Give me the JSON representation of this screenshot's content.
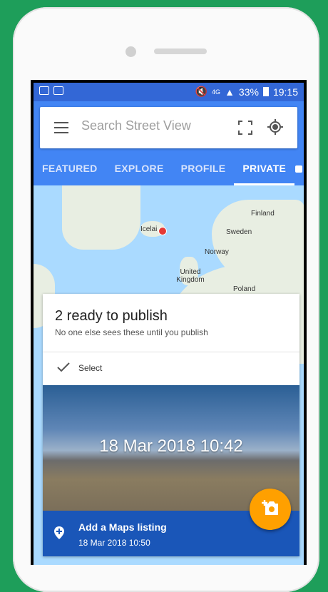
{
  "status_bar": {
    "battery": "33%",
    "time": "19:15",
    "network": "4G"
  },
  "search": {
    "placeholder": "Search Street View"
  },
  "tabs": [
    {
      "label": "FEATURED"
    },
    {
      "label": "EXPLORE"
    },
    {
      "label": "PROFILE"
    },
    {
      "label": "PRIVATE",
      "active": true
    }
  ],
  "map_labels": [
    "Icelai",
    "Finland",
    "Sweden",
    "Norway",
    "United Kingdom",
    "Poland"
  ],
  "card": {
    "title": "2 ready to publish",
    "subtitle": "No one else sees these until you publish",
    "select_label": "Select",
    "photo_date": "18 Mar 2018 10:42",
    "listing_title": "Add a Maps listing",
    "listing_date": "18 Mar 2018 10:50"
  },
  "colors": {
    "accent": "#4285f4",
    "status_bar": "#3367d6",
    "fab": "#ffa000",
    "listing": "#1a56b8",
    "pin": "#e53935"
  },
  "icons": [
    "menu-icon",
    "fullscreen-icon",
    "my-location-icon",
    "lock-icon",
    "check-icon",
    "place-icon",
    "add-camera-icon"
  ]
}
